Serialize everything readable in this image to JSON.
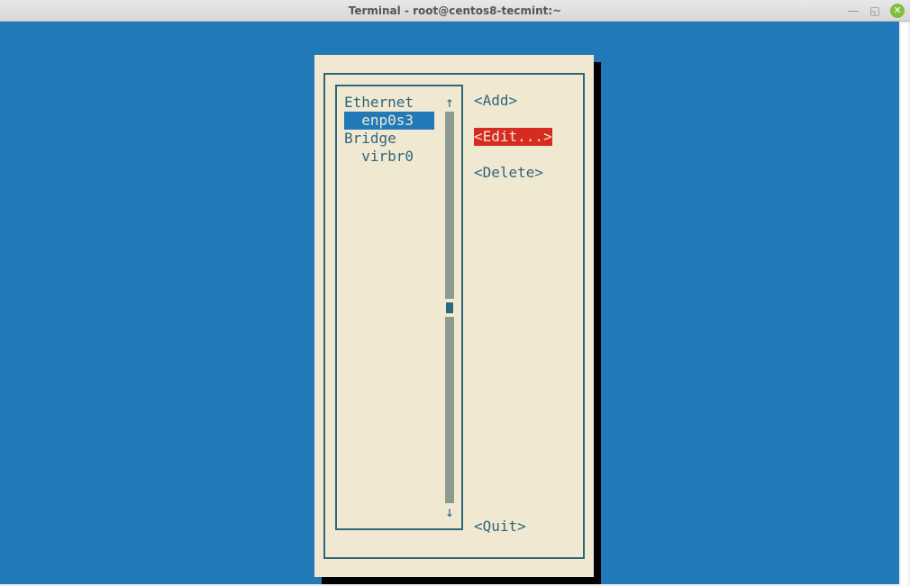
{
  "window": {
    "title": "Terminal - root@centos8-tecmint:~"
  },
  "dialog": {
    "connections": [
      {
        "label": "Ethernet",
        "indent": 0,
        "selected": false,
        "isHeader": true
      },
      {
        "label": "enp0s3",
        "indent": 2,
        "selected": true,
        "isHeader": false
      },
      {
        "label": "Bridge",
        "indent": 0,
        "selected": false,
        "isHeader": true
      },
      {
        "label": "virbr0",
        "indent": 2,
        "selected": false,
        "isHeader": false
      }
    ],
    "scroll": {
      "upArrow": "↑",
      "downArrow": "↓"
    },
    "buttons": {
      "add": "<Add>",
      "edit": "<Edit...>",
      "delete": "<Delete>",
      "quit": "<Quit>"
    }
  }
}
